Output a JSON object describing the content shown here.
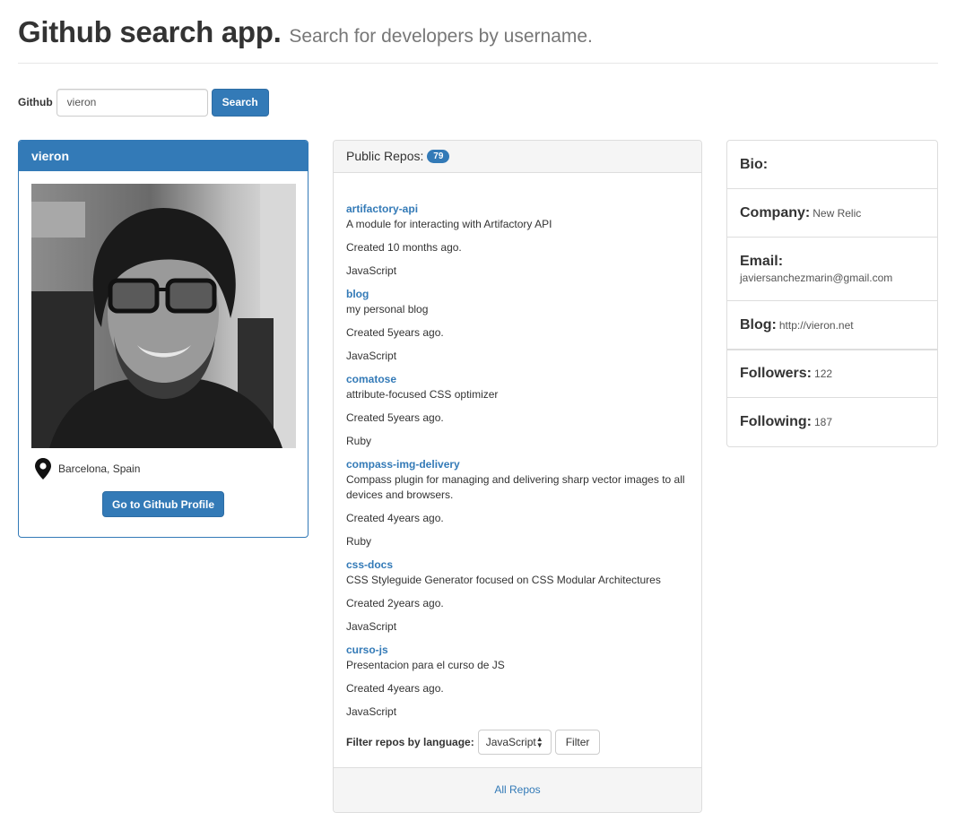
{
  "header": {
    "title": "Github search app.",
    "subtitle": "Search for developers by username."
  },
  "search": {
    "label": "Github",
    "value": "vieron",
    "button": "Search"
  },
  "profile": {
    "username": "vieron",
    "location": "Barcelona, Spain",
    "button": "Go to Github Profile"
  },
  "repos": {
    "heading": "Public Repos:",
    "count": "79",
    "items": [
      {
        "name": "artifactory-api",
        "description": "A module for interacting with Artifactory API",
        "created": "Created 10 months ago.",
        "language": "JavaScript"
      },
      {
        "name": "blog",
        "description": "my personal blog",
        "created": "Created 5years ago.",
        "language": "JavaScript"
      },
      {
        "name": "comatose",
        "description": "attribute-focused CSS optimizer",
        "created": "Created 5years ago.",
        "language": "Ruby"
      },
      {
        "name": "compass-img-delivery",
        "description": "Compass plugin for managing and delivering sharp vector images to all devices and browsers.",
        "created": "Created 4years ago.",
        "language": "Ruby"
      },
      {
        "name": "css-docs",
        "description": "CSS Styleguide Generator focused on CSS Modular Architectures",
        "created": "Created 2years ago.",
        "language": "JavaScript"
      },
      {
        "name": "curso-js",
        "description": "Presentacion para el curso de JS",
        "created": "Created 4years ago.",
        "language": "JavaScript"
      }
    ],
    "filter_label": "Filter repos by language:",
    "filter_selected": "JavaScript",
    "filter_button": "Filter",
    "footer_link": "All Repos"
  },
  "info": {
    "bio_label": "Bio:",
    "company_label": "Company:",
    "company": "New Relic",
    "email_label": "Email:",
    "email": "javiersanchezmarin@gmail.com",
    "blog_label": "Blog:",
    "blog": "http://vieron.net",
    "followers_label": "Followers:",
    "followers": "122",
    "following_label": "Following:",
    "following": "187"
  },
  "colors": {
    "primary": "#337ab7",
    "panel_bg": "#f5f5f5",
    "border": "#dddddd"
  },
  "icons": {
    "location": "map-marker-icon",
    "select": "select-arrows-icon"
  }
}
